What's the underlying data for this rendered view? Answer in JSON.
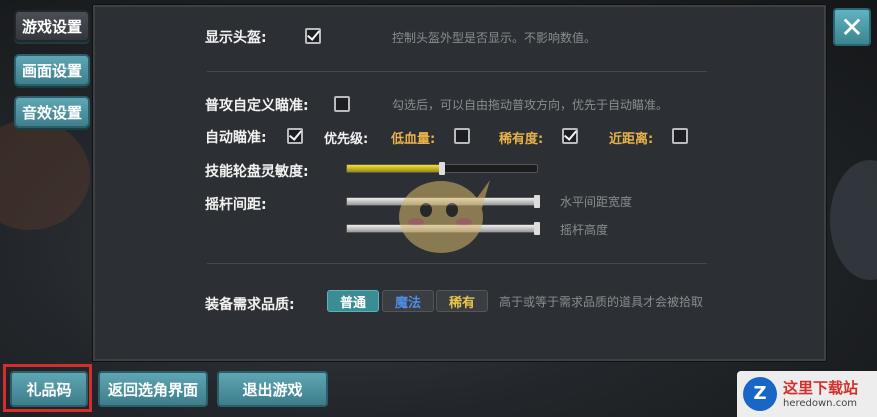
{
  "sidebar": {
    "tabs": [
      {
        "label": "游戏设置"
      },
      {
        "label": "画面设置"
      },
      {
        "label": "音效设置"
      }
    ]
  },
  "settings": {
    "show_helmet": {
      "label": "显示头盔:",
      "checked": true,
      "hint": "控制头盔外型是否显示。不影响数值。"
    },
    "custom_aim": {
      "label": "普攻自定义瞄准:",
      "checked": false,
      "hint": "勾选后，可以自由拖动普攻方向，优先于自动瞄准。"
    },
    "auto_aim": {
      "label": "自动瞄准:",
      "checked": true
    },
    "priority": {
      "label": "优先级:",
      "low_hp": {
        "label": "低血量:",
        "checked": false
      },
      "rarity": {
        "label": "稀有度:",
        "checked": true
      },
      "nearest": {
        "label": "近距离:",
        "checked": false
      }
    },
    "wheel_sensitivity": {
      "label": "技能轮盘灵敏度:",
      "value": 0.5
    },
    "joystick": {
      "label": "摇杆间距:",
      "horizontal": {
        "value": 1.0,
        "hint": "水平间距宽度"
      },
      "height": {
        "value": 1.0,
        "hint": "摇杆高度"
      }
    },
    "quality": {
      "label": "装备需求品质:",
      "options": [
        {
          "label": "普通",
          "color": "#ffffff",
          "selected": true
        },
        {
          "label": "魔法",
          "color": "#4f8ce6",
          "selected": false
        },
        {
          "label": "稀有",
          "color": "#e8c64a",
          "selected": false
        }
      ],
      "hint": "高于或等于需求品质的道具才会被拾取"
    }
  },
  "bottom": {
    "gift_code": "礼品码",
    "back_to_select": "返回选角界面",
    "exit_game": "退出游戏"
  },
  "close_icon": "close-icon",
  "watermark": {
    "title": "这里下载站",
    "url": "heredown.com",
    "logo": "Z"
  }
}
